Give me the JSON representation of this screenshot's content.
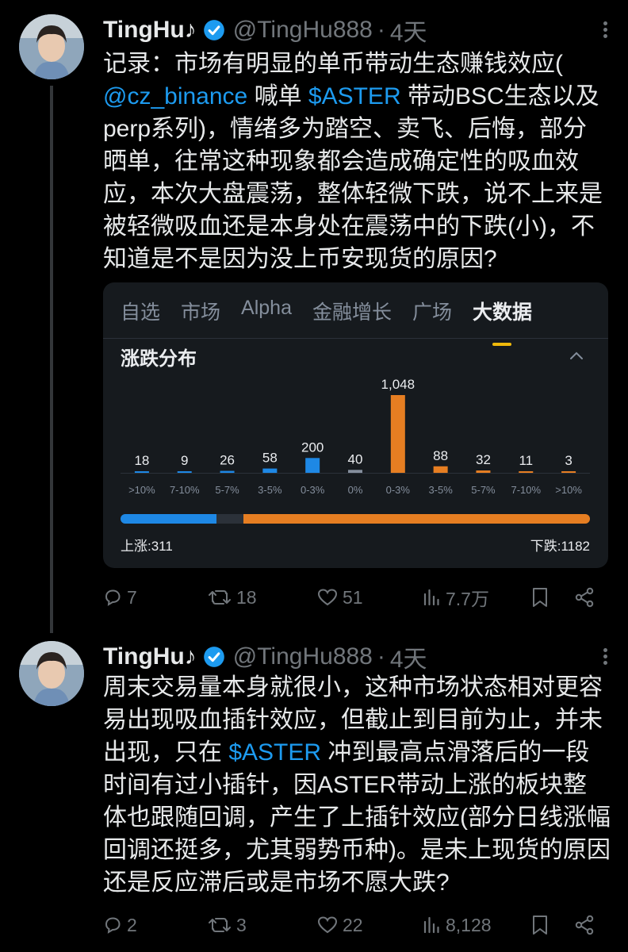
{
  "tweets": [
    {
      "name": "TingHu♪",
      "handle": "@TingHu888",
      "dot": "·",
      "time": "4天",
      "text_parts": {
        "p1": "记录：市场有明显的单币带动生态赚钱效应",
        "p2": "(",
        "mention": "@cz_binance",
        "p3": " 喊单 ",
        "cashtag": "$ASTER",
        "p4": " 带动BSC生态以及perp系列)，情绪多为踏空、卖飞、后悔，部分晒单，往常这种现象都会造成确定性的吸血效应，本次大盘震荡，整体轻微下跌，说不上来是被轻微吸血还是本身处在震荡中的下跌(小)，不知道是不是因为没上币安现货的原因?"
      },
      "actions": {
        "replies": "7",
        "retweets": "18",
        "likes": "51",
        "views": "7.7万"
      }
    },
    {
      "name": "TingHu♪",
      "handle": "@TingHu888",
      "dot": "·",
      "time": "4天",
      "text_parts": {
        "p1": "周末交易量本身就很小，这种市场状态相对更容易出现吸血插针效应，但截止到目前为止，并未出现，只在 ",
        "cashtag": "$ASTER",
        "p2": " 冲到最高点滑落后的一段时间有过小插针，因ASTER带动上涨的板块整体也跟随回调，产生了上插针效应(部分日线涨幅回调还挺多，尤其弱势币种)。是未上现货的原因还是反应滞后或是市场不愿大跌?"
      },
      "actions": {
        "replies": "2",
        "retweets": "3",
        "likes": "22",
        "views": "8,128"
      }
    }
  ],
  "card": {
    "tabs": [
      "自选",
      "市场",
      "Alpha",
      "金融增长",
      "广场",
      "大数据"
    ],
    "active_tab": "大数据",
    "section_title": "涨跌分布",
    "up_label": "上涨:311",
    "down_label": "下跌:1182",
    "up_count": 311,
    "down_count": 1182
  },
  "chart_data": {
    "type": "bar",
    "title": "涨跌分布",
    "categories": [
      ">10%",
      "7-10%",
      "5-7%",
      "3-5%",
      "0-3%",
      "0%",
      "0-3%",
      "3-5%",
      "5-7%",
      "7-10%",
      ">10%"
    ],
    "values": [
      18,
      9,
      26,
      58,
      200,
      40,
      1048,
      88,
      32,
      11,
      3
    ],
    "value_labels": [
      "18",
      "9",
      "26",
      "58",
      "200",
      "40",
      "1,048",
      "88",
      "32",
      "11",
      "3"
    ],
    "colors": [
      "#1e88e5",
      "#1e88e5",
      "#1e88e5",
      "#1e88e5",
      "#1e88e5",
      "#848e9c",
      "#e67e22",
      "#e67e22",
      "#e67e22",
      "#e67e22",
      "#e67e22"
    ],
    "ylim": [
      0,
      1048
    ]
  },
  "colors": {
    "accent": "#1d9bf0",
    "up": "#1e88e5",
    "down": "#e67e22",
    "flat": "#848e9c",
    "tab_indicator": "#f0b90b"
  }
}
